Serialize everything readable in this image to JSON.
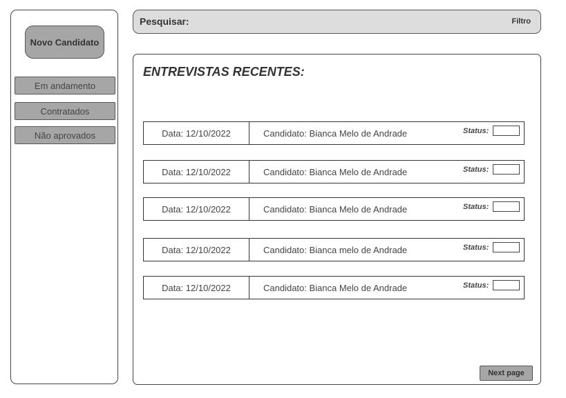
{
  "sidebar": {
    "new_candidate_label": "Novo Candidato",
    "items": [
      {
        "label": "Em andamento"
      },
      {
        "label": "Contratados"
      },
      {
        "label": "Não aprovados"
      }
    ]
  },
  "search": {
    "label": "Pesquisar:",
    "filter_label": "Filtro"
  },
  "main": {
    "title": "ENTREVISTAS RECENTES:",
    "rows": [
      {
        "date": "Data: 12/10/2022",
        "candidate": "Candidato: Bianca Melo de Andrade",
        "status_label": "Status:"
      },
      {
        "date": "Data: 12/10/2022",
        "candidate": "Candidato: Bianca Melo de Andrade",
        "status_label": "Status:"
      },
      {
        "date": "Data: 12/10/2022",
        "candidate": "Candidato: Bianca Melo de Andrade",
        "status_label": "Status:"
      },
      {
        "date": "Data: 12/10/2022",
        "candidate": "Candidato: Bianca melo de Andrade",
        "status_label": "Status:"
      },
      {
        "date": "Data: 12/10/2022",
        "candidate": "Candidato: Bianca Melo de Andrade",
        "status_label": "Status:"
      }
    ],
    "next_page_label": "Next page"
  }
}
